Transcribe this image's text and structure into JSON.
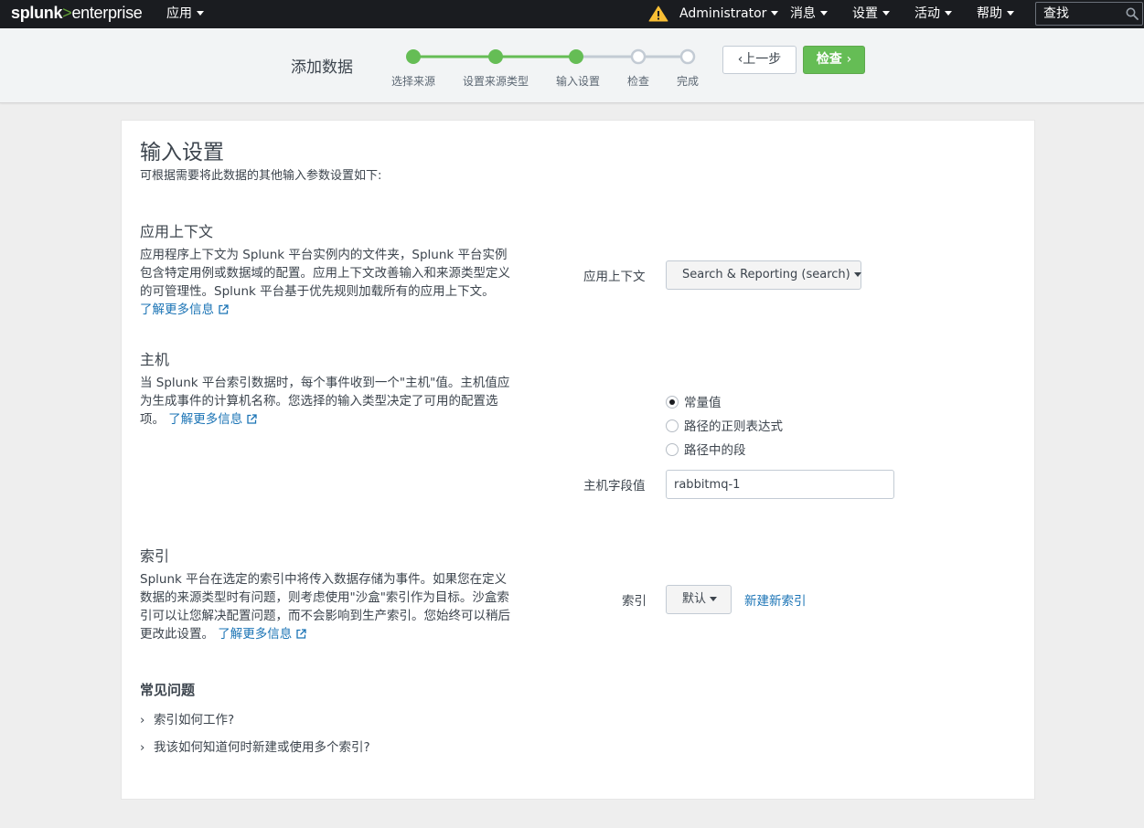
{
  "topbar": {
    "logo_splunk": "splunk",
    "logo_gt": ">",
    "logo_enterprise": "enterprise",
    "apps_label": "应用",
    "user_label": "Administrator",
    "messages_label": "消息",
    "settings_label": "设置",
    "activity_label": "活动",
    "help_label": "帮助",
    "search_placeholder": "查找"
  },
  "wizard": {
    "title": "添加数据",
    "steps": [
      {
        "label": "选择来源",
        "done": true
      },
      {
        "label": "设置来源类型",
        "done": true
      },
      {
        "label": "输入设置",
        "done": true
      },
      {
        "label": "检查",
        "done": false
      },
      {
        "label": "完成",
        "done": false
      }
    ],
    "prev_label": "上一步",
    "next_label": "检查",
    "colors": {
      "done": "#65bd55",
      "pending": "#c3cbd4"
    }
  },
  "page": {
    "title": "输入设置",
    "subtitle": "可根据需要将此数据的其他输入参数设置如下:"
  },
  "app_context": {
    "title": "应用上下文",
    "desc": "应用程序上下文为 Splunk 平台实例内的文件夹，Splunk 平台实例包含特定用例或数据域的配置。应用上下文改善输入和来源类型定义的可管理性。Splunk 平台基于优先规则加载所有的应用上下文。",
    "learn_more": "了解更多信息",
    "field_label": "应用上下文",
    "selected": "Search & Reporting (search)"
  },
  "host": {
    "title": "主机",
    "desc": "当 Splunk 平台索引数据时，每个事件收到一个\"主机\"值。主机值应为生成事件的计算机名称。您选择的输入类型决定了可用的配置选项。",
    "learn_more": "了解更多信息",
    "options": [
      "常量值",
      "路径的正则表达式",
      "路径中的段"
    ],
    "selected_index": 0,
    "field_label": "主机字段值",
    "field_value": "rabbitmq-1"
  },
  "index": {
    "title": "索引",
    "desc": "Splunk 平台在选定的索引中将传入数据存储为事件。如果您在定义数据的来源类型时有问题，则考虑使用\"沙盒\"索引作为目标。沙盒索引可以让您解决配置问题，而不会影响到生产索引。您始终可以稍后更改此设置。",
    "learn_more": "了解更多信息",
    "field_label": "索引",
    "selected": "默认",
    "new_index_link": "新建新索引"
  },
  "faq": {
    "title": "常见问题",
    "items": [
      "索引如何工作?",
      "我该如何知道何时新建或使用多个索引?"
    ]
  }
}
